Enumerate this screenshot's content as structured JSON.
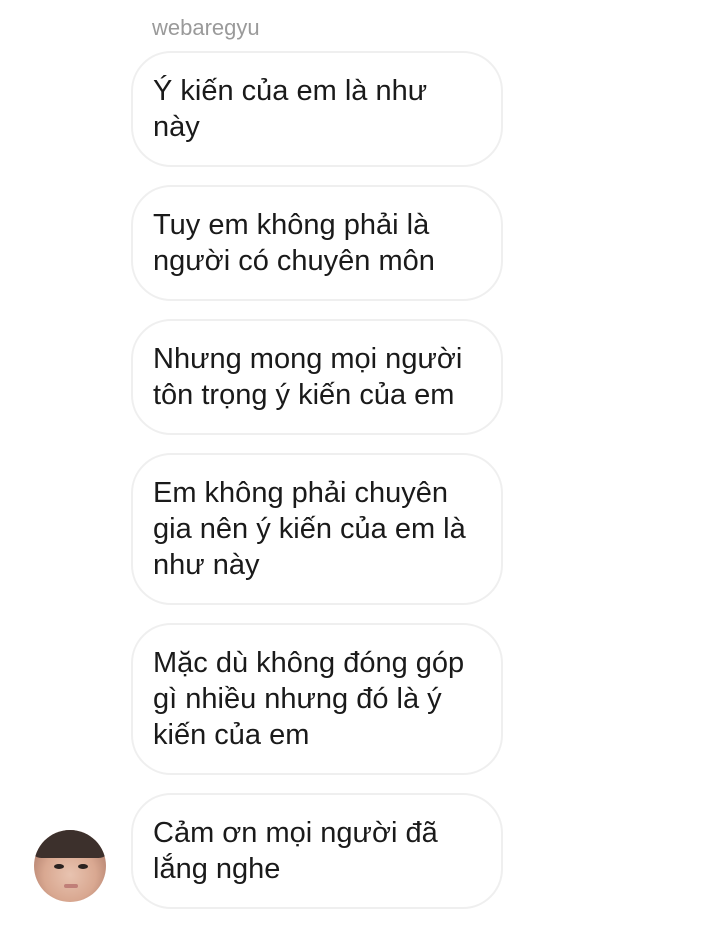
{
  "conversation": {
    "sender": "webaregyu",
    "messages": [
      {
        "text": "Ý kiến của em là như này"
      },
      {
        "text": "Tuy em không phải là\nngười có chuyên môn"
      },
      {
        "text": "Nhưng mong mọi người\ntôn trọng ý kiến của em"
      },
      {
        "text": "Em không phải chuyên\ngia nên ý kiến của em là\nnhư này"
      },
      {
        "text": "Mặc dù không đóng góp\ngì nhiều nhưng đó là ý\nkiến của em"
      },
      {
        "text": "Cảm ơn mọi người đã\nlắng nghe"
      }
    ],
    "avatar_icon": "user-avatar-photo"
  }
}
